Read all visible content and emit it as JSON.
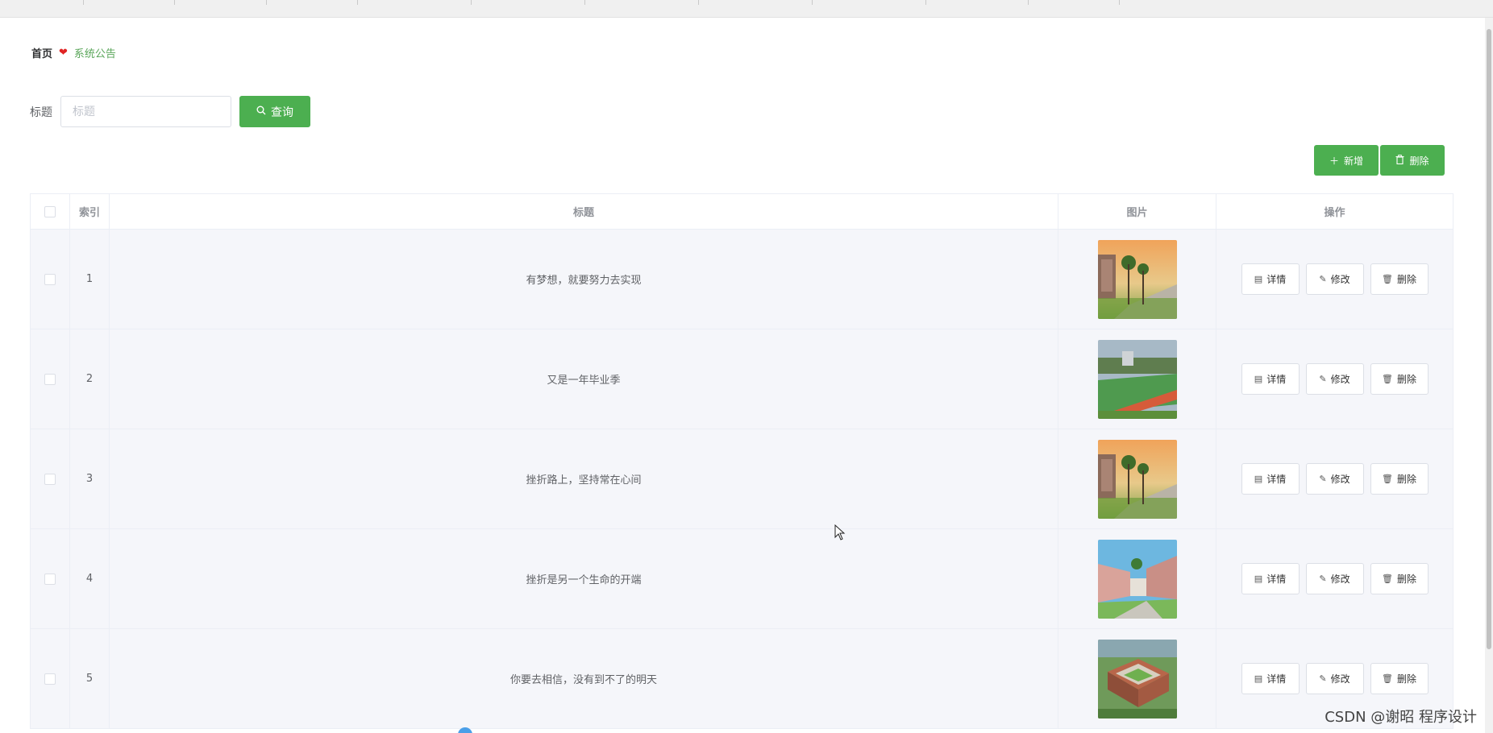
{
  "breadcrumb": {
    "home": "首页",
    "current": "系统公告",
    "heart_icon": "heart-icon"
  },
  "search": {
    "label": "标题",
    "placeholder": "标题",
    "value": "",
    "button_label": "查询",
    "button_icon": "search-icon"
  },
  "toolbar": {
    "add_label": "新增",
    "delete_label": "删除"
  },
  "table": {
    "headers": {
      "index": "索引",
      "title": "标题",
      "image": "图片",
      "ops": "操作"
    },
    "rows": [
      {
        "index": "1",
        "title": "有梦想，就要努力去实现",
        "image": "campus-sunset"
      },
      {
        "index": "2",
        "title": "又是一年毕业季",
        "image": "campus-track"
      },
      {
        "index": "3",
        "title": "挫折路上，坚持常在心间",
        "image": "campus-sunset"
      },
      {
        "index": "4",
        "title": "挫折是另一个生命的开端",
        "image": "campus-courtyard"
      },
      {
        "index": "5",
        "title": "你要去相信，没有到不了的明天",
        "image": "campus-aerial"
      }
    ],
    "ops": {
      "detail_label": "详情",
      "edit_label": "修改",
      "delete_label": "删除"
    }
  },
  "watermark": "CSDN @谢昭  程序设计",
  "colors": {
    "primary": "#4caf50",
    "breadcrumb_current": "#5aa65a",
    "heart": "#e02424"
  }
}
